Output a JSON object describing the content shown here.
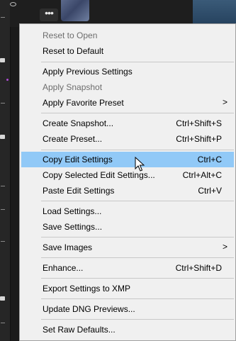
{
  "menu": {
    "items": [
      {
        "label": "Reset to Open",
        "shortcut": "",
        "submenu": false,
        "disabled": true,
        "highlighted": false
      },
      {
        "label": "Reset to Default",
        "shortcut": "",
        "submenu": false,
        "disabled": false,
        "highlighted": false
      },
      {
        "label": "Apply Previous Settings",
        "shortcut": "",
        "submenu": false,
        "disabled": false,
        "highlighted": false
      },
      {
        "label": "Apply Snapshot",
        "shortcut": "",
        "submenu": false,
        "disabled": true,
        "highlighted": false
      },
      {
        "label": "Apply Favorite Preset",
        "shortcut": "",
        "submenu": true,
        "disabled": false,
        "highlighted": false
      },
      {
        "label": "Create Snapshot...",
        "shortcut": "Ctrl+Shift+S",
        "submenu": false,
        "disabled": false,
        "highlighted": false
      },
      {
        "label": "Create Preset...",
        "shortcut": "Ctrl+Shift+P",
        "submenu": false,
        "disabled": false,
        "highlighted": false
      },
      {
        "label": "Copy Edit Settings",
        "shortcut": "Ctrl+C",
        "submenu": false,
        "disabled": false,
        "highlighted": true
      },
      {
        "label": "Copy Selected Edit Settings...",
        "shortcut": "Ctrl+Alt+C",
        "submenu": false,
        "disabled": false,
        "highlighted": false
      },
      {
        "label": "Paste Edit Settings",
        "shortcut": "Ctrl+V",
        "submenu": false,
        "disabled": false,
        "highlighted": false
      },
      {
        "label": "Load Settings...",
        "shortcut": "",
        "submenu": false,
        "disabled": false,
        "highlighted": false
      },
      {
        "label": "Save Settings...",
        "shortcut": "",
        "submenu": false,
        "disabled": false,
        "highlighted": false
      },
      {
        "label": "Save Images",
        "shortcut": "",
        "submenu": true,
        "disabled": false,
        "highlighted": false
      },
      {
        "label": "Enhance...",
        "shortcut": "Ctrl+Shift+D",
        "submenu": false,
        "disabled": false,
        "highlighted": false
      },
      {
        "label": "Export Settings to XMP",
        "shortcut": "",
        "submenu": false,
        "disabled": false,
        "highlighted": false
      },
      {
        "label": "Update DNG Previews...",
        "shortcut": "",
        "submenu": false,
        "disabled": false,
        "highlighted": false
      },
      {
        "label": "Set Raw Defaults...",
        "shortcut": "",
        "submenu": false,
        "disabled": false,
        "highlighted": false
      }
    ],
    "submenu_arrow": ">"
  },
  "toolbar": {
    "more_label": "•••"
  },
  "icons": {
    "more": "more-icon",
    "visibility": "eye-icon",
    "cursor": "mouse-pointer-icon",
    "submenu": "chevron-right-icon"
  },
  "colors": {
    "menu_bg": "#f0f0f0",
    "highlight": "#91c9f7",
    "disabled_text": "#6d6d6d",
    "app_bg": "#1a1a1a"
  }
}
